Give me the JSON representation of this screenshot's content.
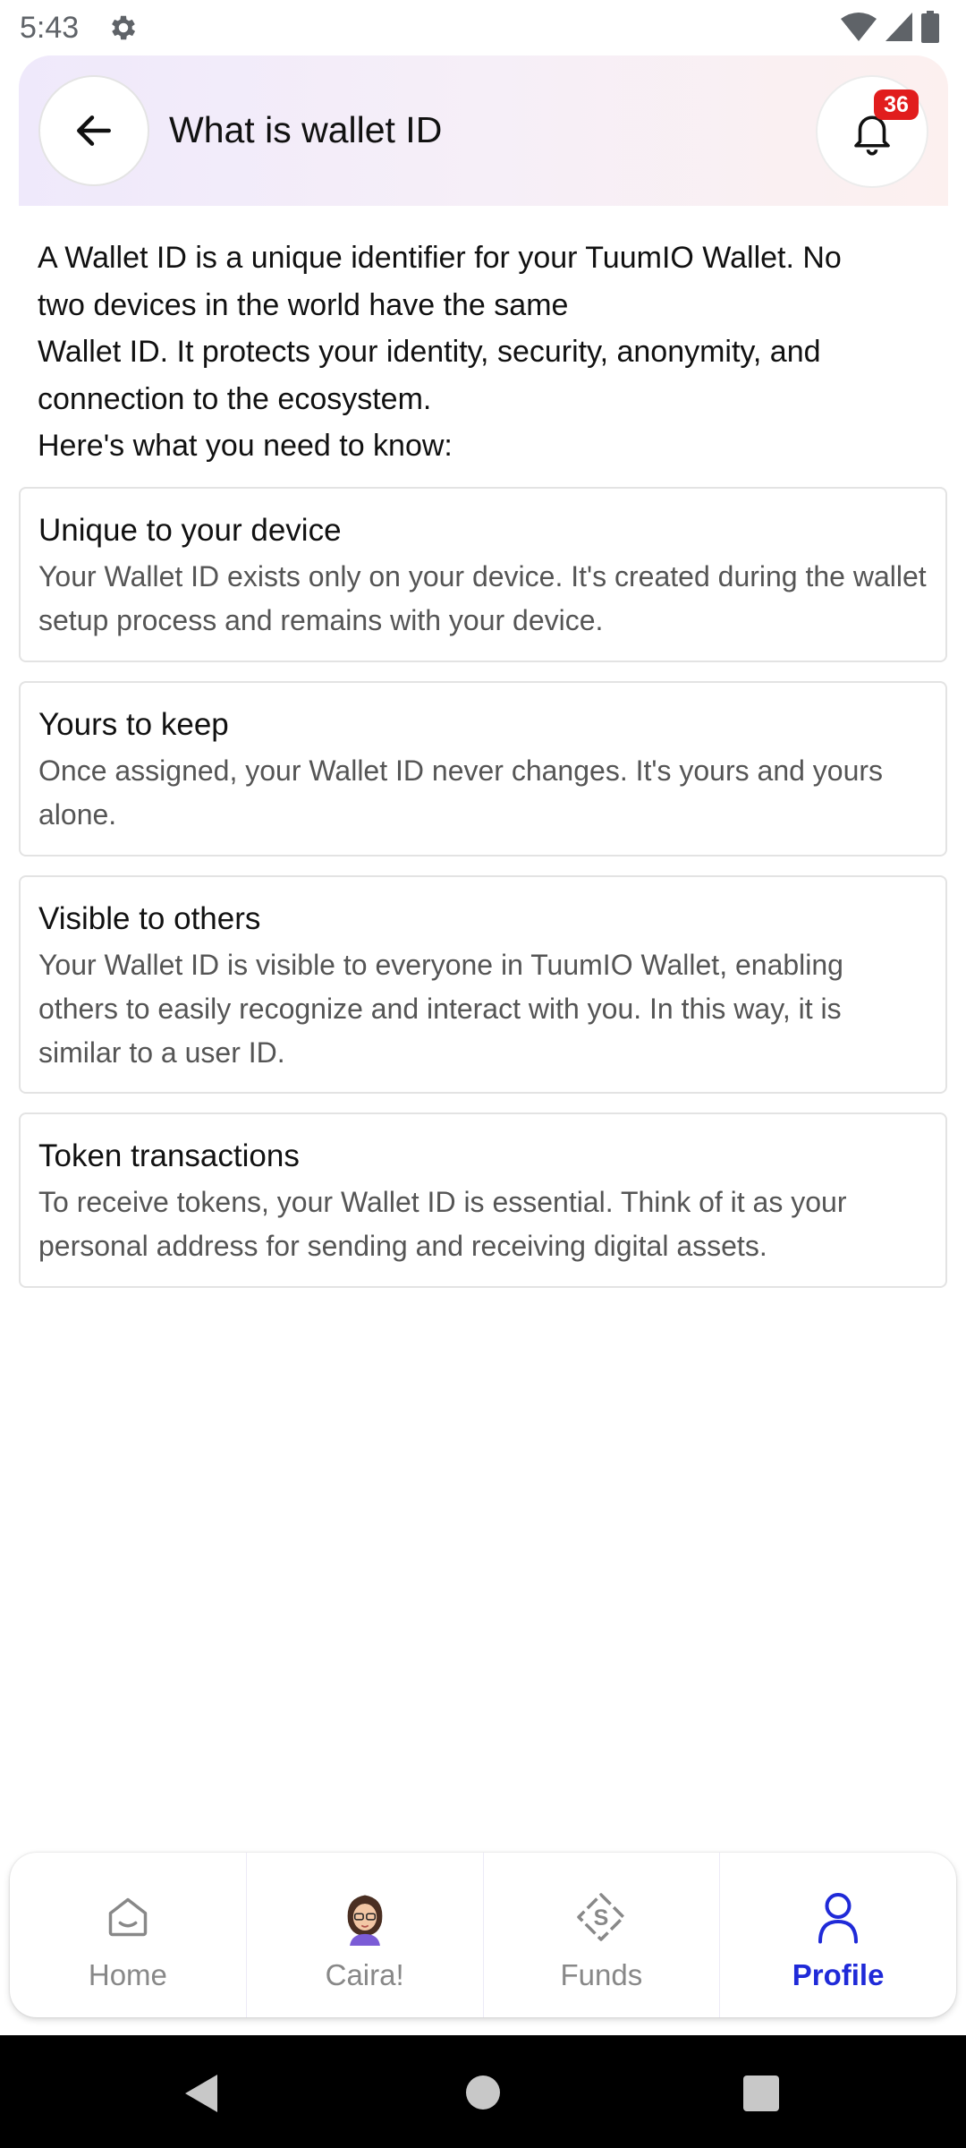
{
  "status_bar": {
    "time": "5:43",
    "icons": [
      "gear-icon",
      "wifi-icon",
      "signal-icon",
      "battery-icon"
    ]
  },
  "header": {
    "title": "What is wallet ID",
    "notification_count": "36",
    "back_icon": "arrow-left-icon",
    "bell_icon": "bell-icon"
  },
  "intro": {
    "lines": [
      "A Wallet ID is a unique identifier for your TuumIO Wallet. No",
      "two devices in the world have the same",
      "Wallet ID. It protects your identity, security, anonymity, and",
      "connection to the ecosystem.",
      "Here's what you need to know:"
    ]
  },
  "cards": [
    {
      "title": "Unique to your device",
      "text": "Your Wallet ID exists only on your device. It's created during the wallet setup process and remains with your device."
    },
    {
      "title": "Yours to keep",
      "text": "Once assigned, your Wallet ID never changes. It's yours and yours alone."
    },
    {
      "title": "Visible to others",
      "text": "Your Wallet ID is visible to everyone in TuumIO Wallet, enabling others to easily recognize and interact with you. In this way, it is similar to a user ID."
    },
    {
      "title": "Token transactions",
      "text": "To receive tokens, your Wallet ID is essential. Think of it as your personal address for sending and receiving digital assets."
    }
  ],
  "bottom_nav": {
    "items": [
      {
        "label": "Home",
        "icon": "home-icon",
        "active": false
      },
      {
        "label": "Caira!",
        "icon": "avatar-icon",
        "active": false
      },
      {
        "label": "Funds",
        "icon": "funds-icon",
        "active": false
      },
      {
        "label": "Profile",
        "icon": "profile-icon",
        "active": true
      }
    ]
  },
  "colors": {
    "accent": "#1f2ad8",
    "badge": "#e11d1d",
    "header_gradient_start": "#efe9fb",
    "header_gradient_end": "#fcf0ef"
  }
}
